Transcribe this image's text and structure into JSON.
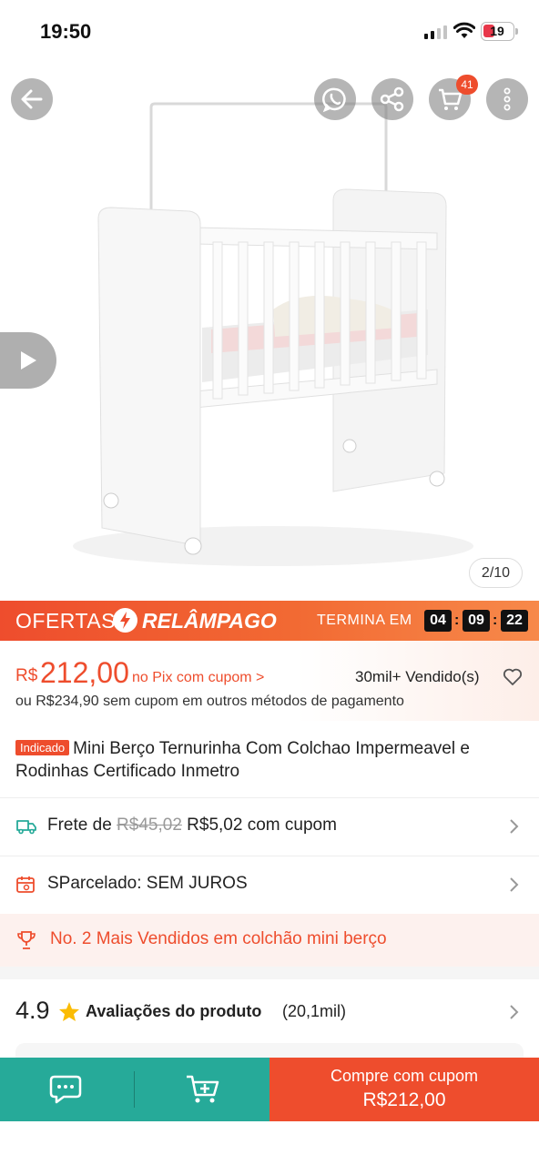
{
  "status_bar": {
    "time": "19:50",
    "battery": "19"
  },
  "gallery": {
    "counter": "2/10",
    "cart_count": "41",
    "icons": [
      "back-arrow-icon",
      "whatsapp-icon",
      "share-icon",
      "cart-icon",
      "more-vertical-icon",
      "play-icon"
    ]
  },
  "flash_sale": {
    "label_left": "OFERTAS",
    "label_right": "RELÂMPAGO",
    "ends_label": "TERMINA EM",
    "hours": "04",
    "minutes": "09",
    "seconds": "22"
  },
  "price": {
    "currency": "R$",
    "value": "212,00",
    "pix_note": "no Pix com cupom >",
    "sold": "30mil+ Vendido(s)",
    "alt_price": "ou R$234,90 sem cupom em outros métodos de pagamento"
  },
  "product": {
    "badge": "Indicado",
    "title": "Mini Berço Ternurinha Com Colchao Impermeavel e Rodinhas Certificado Inmetro"
  },
  "shipping": {
    "prefix": "Frete de",
    "old_price": "R$45,02",
    "new_price": "R$5,02 com cupom"
  },
  "installments": {
    "text": "SParcelado: SEM JUROS"
  },
  "ranking": {
    "text": "No. 2 Mais Vendidos em colchão mini berço"
  },
  "rating": {
    "score": "4.9",
    "label": "Avaliações do produto",
    "count": "(20,1mil)"
  },
  "bottom_bar": {
    "buy_label": "Compre com cupom",
    "buy_price": "R$212,00"
  },
  "colors": {
    "accent": "#ee4d2d",
    "teal": "#26aa99"
  }
}
